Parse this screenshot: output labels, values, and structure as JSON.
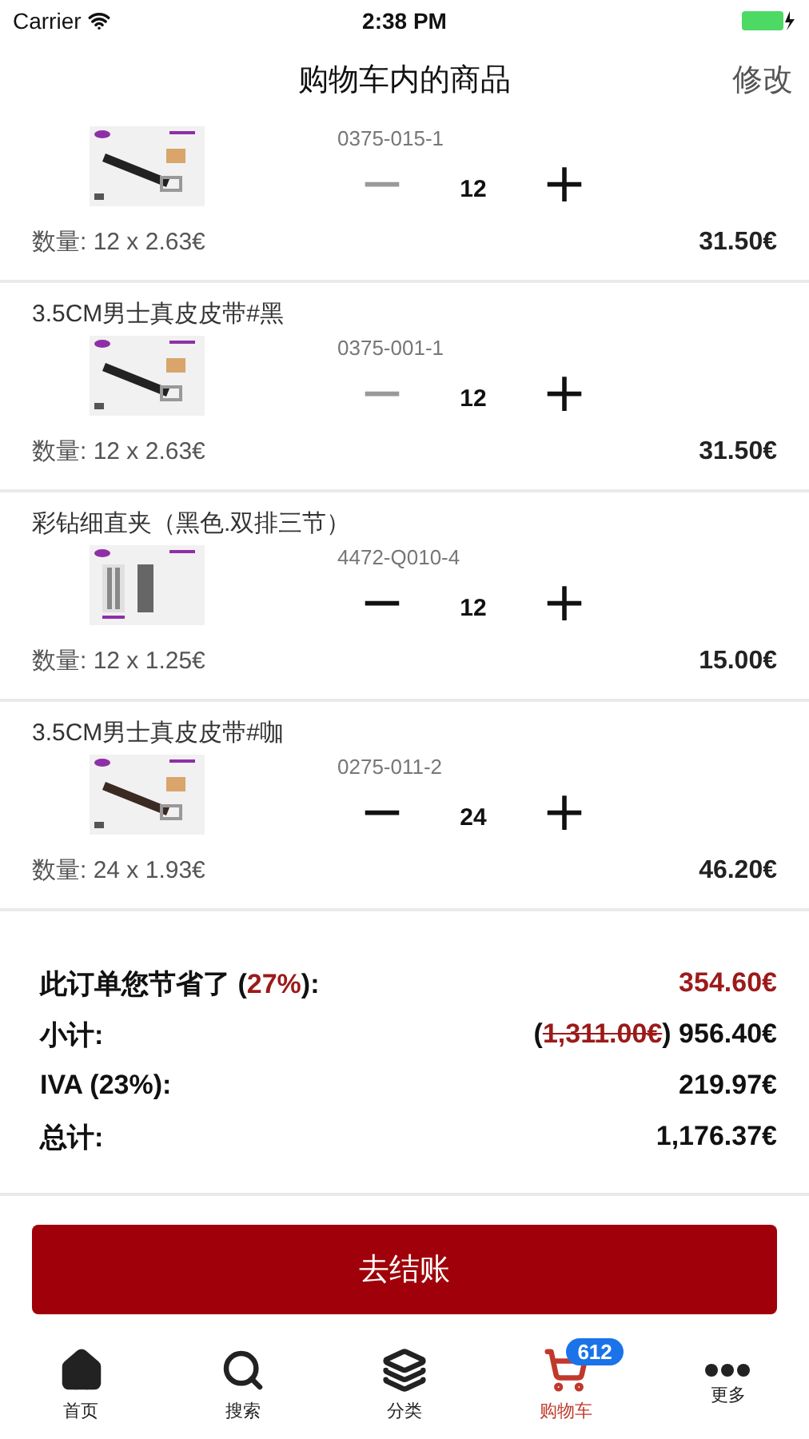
{
  "status_bar": {
    "carrier": "Carrier",
    "time": "2:38 PM"
  },
  "nav": {
    "title": "购物车内的商品",
    "action": "修改"
  },
  "items": [
    {
      "code": "0375-015-1",
      "quantity": "12",
      "minus_disabled": true,
      "unit": "数量: 12 x 2.63€",
      "total": "31.50€",
      "kind": "picture"
    },
    {
      "title": "3.5CM男士真皮皮带#黑",
      "code": "0375-001-1",
      "quantity": "12",
      "minus_disabled": true,
      "unit": "数量: 12 x 2.63€",
      "total": "31.50€",
      "kind": "picture"
    },
    {
      "title": "彩钻细直夹（黑色.双排三节）",
      "code": "4472-Q010-4",
      "quantity": "12",
      "minus_disabled": false,
      "unit": "数量: 12 x 1.25€",
      "total": "15.00€",
      "kind": "picture"
    },
    {
      "title": "3.5CM男士真皮皮带#咖",
      "code": "0275-011-2",
      "quantity": "24",
      "minus_disabled": false,
      "unit": "数量: 24 x 1.93€",
      "total": "46.20€",
      "kind": "picture"
    }
  ],
  "minus_sign": "−",
  "plus_sign": "+",
  "summary": {
    "savings": {
      "label_before": "此订单您节省了 (",
      "percent": "27%",
      "label_after": "):",
      "value": "354.60€"
    },
    "subtotal": {
      "label": "小计:",
      "open": "(",
      "original": "1,311.00€",
      "close": ")",
      "value": "956.40€"
    },
    "tax": {
      "label": "IVA (23%):",
      "value": "219.97€"
    },
    "total": {
      "label": "总计:",
      "value": "1,176.37€"
    }
  },
  "checkout": "去结账",
  "tabs": [
    {
      "label": "首页",
      "kind": "home",
      "selected": false
    },
    {
      "label": "搜索",
      "kind": "search",
      "selected": false
    },
    {
      "label": "分类",
      "kind": "layers",
      "selected": false
    },
    {
      "label": "购物车",
      "kind": "cart",
      "selected": true,
      "badge": "612"
    },
    {
      "label": "更多",
      "kind": "more",
      "selected": false
    }
  ]
}
